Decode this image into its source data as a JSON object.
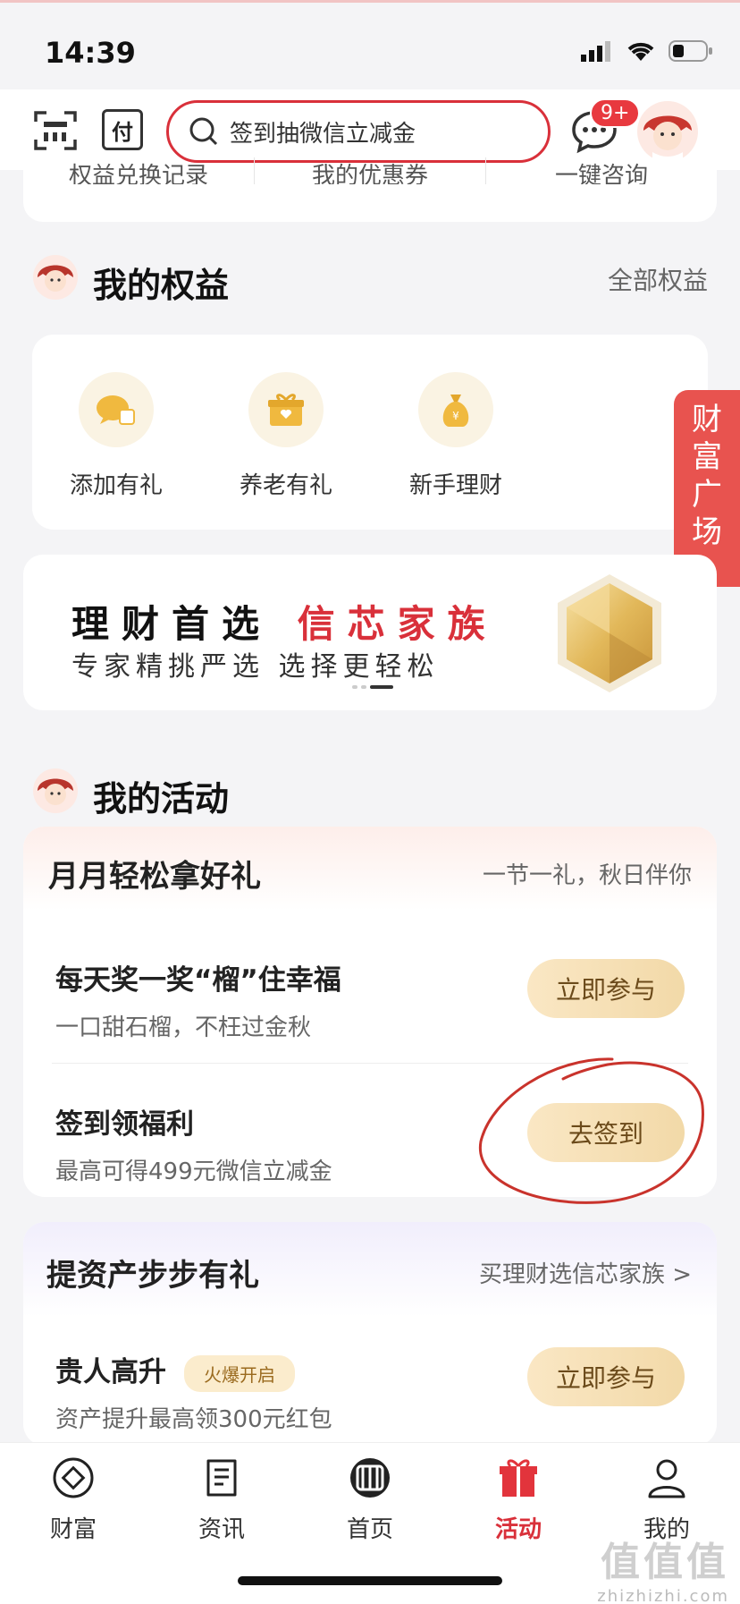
{
  "status": {
    "time": "14:39"
  },
  "header": {
    "pay_label": "付",
    "search_placeholder": "签到抽微信立减金",
    "msg_badge": "9+"
  },
  "quick": [
    "权益兑换记录",
    "我的优惠券",
    "一键咨询"
  ],
  "rights": {
    "title": "我的权益",
    "all_link": "全部权益",
    "items": [
      {
        "label": "添加有礼"
      },
      {
        "label": "养老有礼"
      },
      {
        "label": "新手理财"
      }
    ]
  },
  "side_tab": {
    "lines": [
      "财",
      "富",
      "广",
      "场",
      "«"
    ]
  },
  "banner": {
    "line1_a": "理财首选",
    "line1_b": "信芯家族",
    "line2": "专家精挑严选 选择更轻松"
  },
  "activities": {
    "title": "我的活动",
    "card1": {
      "title": "月月轻松拿好礼",
      "subtitle": "一节一礼，秋日伴你",
      "rows": [
        {
          "title": "每天奖一奖“榴”住幸福",
          "sub": "一口甜石榴，不枉过金秋",
          "button": "立即参与"
        },
        {
          "title": "签到领福利",
          "sub": "最高可得499元微信立减金",
          "button": "去签到"
        }
      ]
    },
    "card2": {
      "title": "提资产步步有礼",
      "link": "买理财选信芯家族 >",
      "row": {
        "title": "贵人高升",
        "tag": "火爆开启",
        "sub": "资产提升最高领300元红包",
        "button": "立即参与"
      }
    }
  },
  "nav": {
    "items": [
      {
        "label": "财富"
      },
      {
        "label": "资讯"
      },
      {
        "label": "首页"
      },
      {
        "label": "活动"
      },
      {
        "label": "我的"
      }
    ],
    "active": "活动"
  },
  "watermark": {
    "main": "值值值",
    "sub": "zhizhizhi.com"
  },
  "colors": {
    "brand_red": "#d9303a",
    "button_gold": "#f2d9a8",
    "side_tab": "#e8534f"
  }
}
